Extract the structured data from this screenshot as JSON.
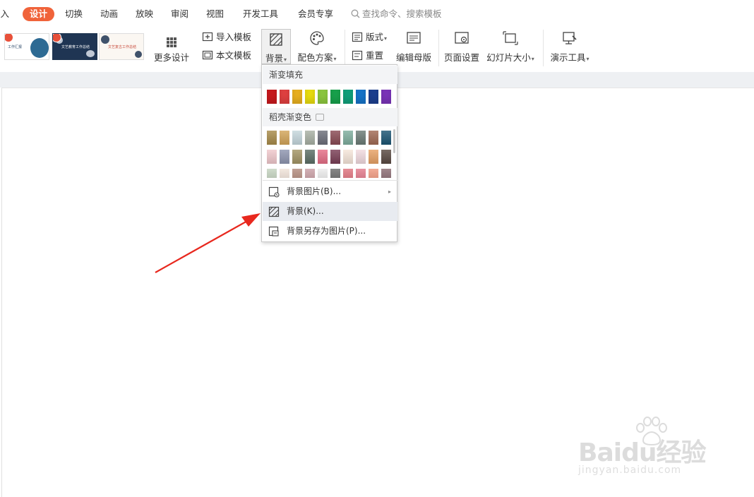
{
  "tabs": {
    "items": [
      {
        "label": "插入"
      },
      {
        "label": "设计"
      },
      {
        "label": "切换"
      },
      {
        "label": "动画"
      },
      {
        "label": "放映"
      },
      {
        "label": "审阅"
      },
      {
        "label": "视图"
      },
      {
        "label": "开发工具"
      },
      {
        "label": "会员专享"
      }
    ],
    "active": "设计",
    "search_placeholder": "查找命令、搜索模板"
  },
  "ribbon": {
    "templates": [
      {
        "title": "工作汇报"
      },
      {
        "title": "文艺教育工作总结"
      },
      {
        "title": "文艺复古工作总结"
      }
    ],
    "more_design": "更多设计",
    "import_template": "导入模板",
    "this_template": "本文模板",
    "background": "背景",
    "color_scheme": "配色方案",
    "layout": "版式",
    "reset": "重置",
    "edit_master": "编辑母版",
    "page_setup": "页面设置",
    "slide_size": "幻灯片大小",
    "presenter_tools": "演示工具"
  },
  "menu": {
    "gradient_fill_header": "渐变填充",
    "gradient_row": [
      "#c7181d",
      "#e04040",
      "#e8b020",
      "#e8dc10",
      "#8cc63e",
      "#17a14c",
      "#10a07a",
      "#1673c8",
      "#1c3f8f",
      "#7a34b8"
    ],
    "docer_header": "稻壳渐变色",
    "docer_rows": [
      [
        "#a88b4a",
        "#d3a55a",
        "#c5d7dd",
        "#a8b0a4",
        "#6c6f7a",
        "#8a4b55",
        "#7fae9e",
        "#6b7b76",
        "#a16a54",
        "#1c5573"
      ],
      [
        "#f0c8cc",
        "#8f96b0",
        "#a39565",
        "#5c6e66",
        "#e56f86",
        "#7a3f56",
        "#f6e6da",
        "#f1dadf",
        "#e8a265",
        "#5a4a42"
      ],
      [
        "#c5d4c0",
        "#f1e4da",
        "#b48d80",
        "#caa0a6",
        "#ececec",
        "#6e6e6e",
        "#e07580",
        "#e37b8c",
        "#f09a80",
        "#8c6d73"
      ]
    ],
    "items": [
      {
        "label": "背景图片(B)...",
        "has_submenu": true
      },
      {
        "label": "背景(K)...",
        "has_submenu": false
      },
      {
        "label": "背景另存为图片(P)...",
        "has_submenu": false
      }
    ],
    "hovered_item": "背景(K)..."
  },
  "watermark": {
    "brand": "Baidu经验",
    "url": "jingyan.baidu.com"
  },
  "colors": {
    "accent": "#f0633a",
    "arrow": "#e8281e",
    "hover": "#e8ebf0"
  }
}
